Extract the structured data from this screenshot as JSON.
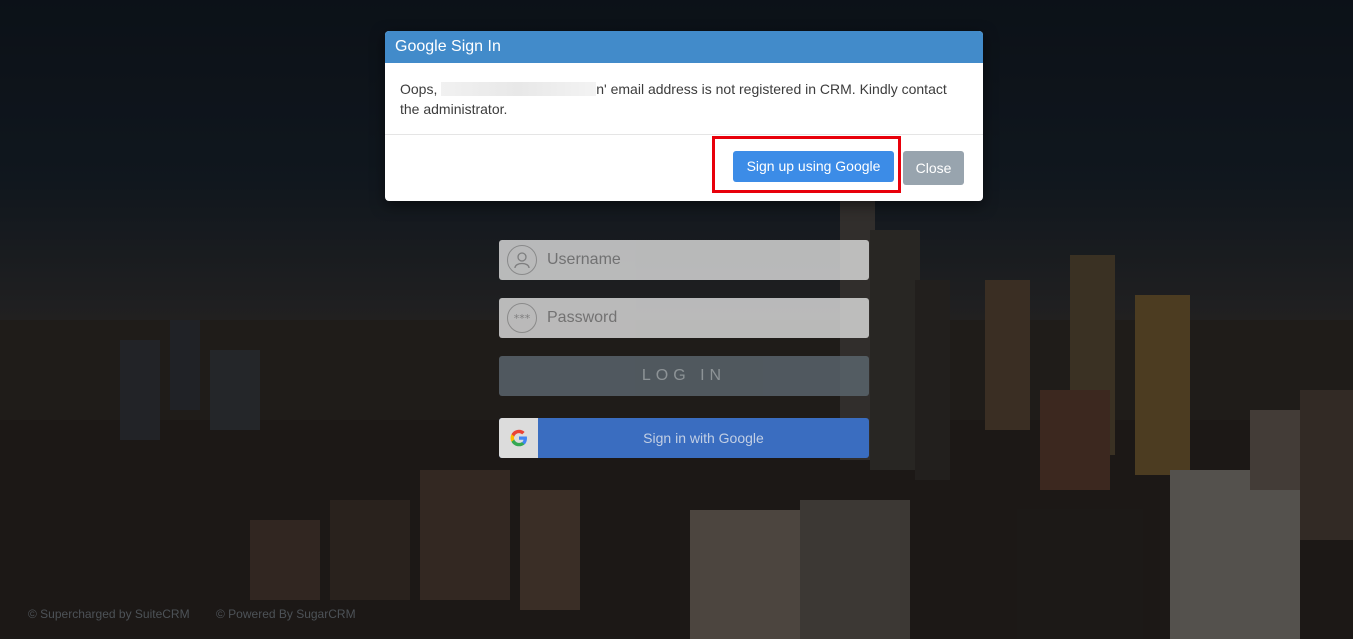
{
  "modal": {
    "title": "Google Sign In",
    "message_prefix": "Oops, ",
    "message_suffix": "n' email address is not registered in CRM. Kindly contact the administrator.",
    "signup_label": "Sign up using Google",
    "close_label": "Close"
  },
  "login": {
    "username_placeholder": "Username",
    "password_placeholder": "Password",
    "password_icon_text": "***",
    "login_label": "LOG IN",
    "google_label": "Sign in with Google"
  },
  "footer": {
    "supercharged": "© Supercharged by SuiteCRM",
    "powered": "© Powered By SugarCRM"
  },
  "colors": {
    "modal_header": "#428bca",
    "primary_button": "#3c8ce7",
    "close_button": "#98a4ae",
    "highlight": "#e8000b",
    "google_button": "#3a6dc0"
  },
  "icons": {
    "username": "user-icon",
    "password": "password-dots-icon",
    "google": "google-g-icon"
  }
}
